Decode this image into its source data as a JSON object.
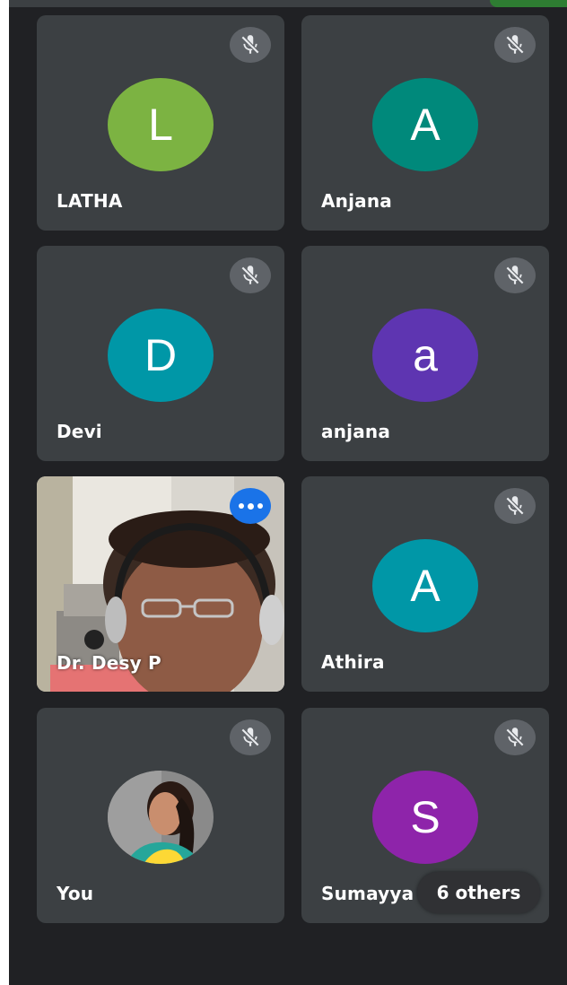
{
  "colors": {
    "background": "#202124",
    "tile": "#3c4043",
    "mute_badge": "#5f6368",
    "active_badge": "#1a73e8"
  },
  "participants": [
    {
      "name": "LATHA",
      "initial": "L",
      "avatar_color": "#7cb342",
      "muted": true,
      "icon": "mic-off-icon"
    },
    {
      "name": "Anjana",
      "initial": "A",
      "avatar_color": "#00897b",
      "muted": true,
      "icon": "mic-off-icon"
    },
    {
      "name": "Devi",
      "initial": "D",
      "avatar_color": "#0097a7",
      "muted": true,
      "icon": "mic-off-icon"
    },
    {
      "name": "anjana",
      "initial": "a",
      "avatar_color": "#5e35b1",
      "muted": true,
      "icon": "mic-off-icon"
    },
    {
      "name": "Dr. Desy P",
      "video": true,
      "muted": false,
      "icon": "more-options-icon"
    },
    {
      "name": "Athira",
      "initial": "A",
      "avatar_color": "#0097a7",
      "muted": true,
      "icon": "mic-off-icon"
    },
    {
      "name": "You",
      "photo": true,
      "muted": true,
      "icon": "mic-off-icon"
    },
    {
      "name": "Sumayya",
      "initial": "S",
      "avatar_color": "#8e24aa",
      "muted": true,
      "icon": "mic-off-icon"
    }
  ],
  "others_chip": {
    "label": "6 others"
  }
}
